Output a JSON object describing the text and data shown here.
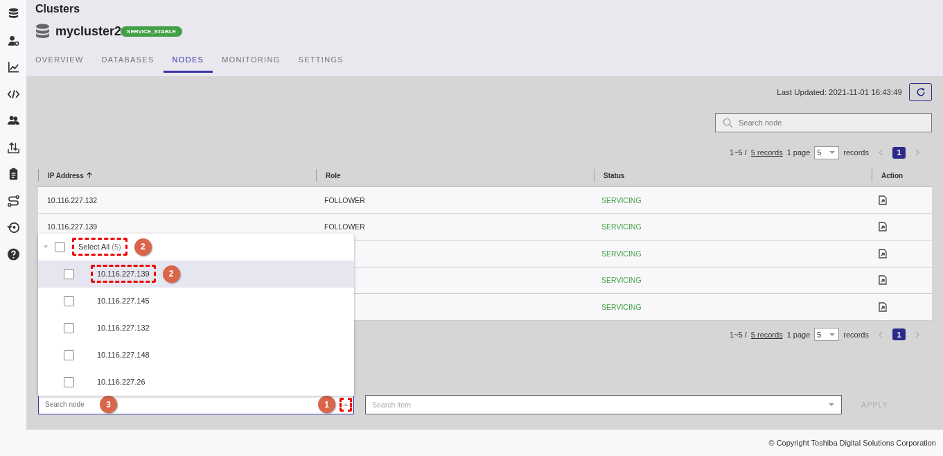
{
  "page": {
    "title": "Clusters"
  },
  "cluster": {
    "name": "mycluster2",
    "status": "SERVICE_STABLE"
  },
  "tabs": [
    {
      "label": "OVERVIEW",
      "selected": false
    },
    {
      "label": "DATABASES",
      "selected": false
    },
    {
      "label": "NODES",
      "selected": true
    },
    {
      "label": "MONITORING",
      "selected": false
    },
    {
      "label": "SETTINGS",
      "selected": false
    }
  ],
  "last_updated": "Last Updated: 2021-11-01 16:43:49",
  "search": {
    "placeholder": "Search node"
  },
  "pagination_top": {
    "range": "1~5 /",
    "records_link": "5 records",
    "per_page_label": "1 page",
    "per_page": "5",
    "records_label": "records",
    "page": "1"
  },
  "table": {
    "columns": [
      {
        "label": "IP Address",
        "sorted": true
      },
      {
        "label": "Role",
        "sorted": false
      },
      {
        "label": "Status",
        "sorted": false
      },
      {
        "label": "Action",
        "sorted": false
      }
    ],
    "rows": [
      {
        "ip": "10.116.227.132",
        "role": "FOLLOWER",
        "status": "SERVICING"
      },
      {
        "ip": "10.116.227.139",
        "role": "FOLLOWER",
        "status": "SERVICING"
      },
      {
        "status": "SERVICING"
      },
      {
        "status": "SERVICING"
      },
      {
        "status": "SERVICING"
      }
    ]
  },
  "pagination_bottom": {
    "range": "1~5 /",
    "records_link": "5 records",
    "per_page_label": "1 page",
    "per_page": "5",
    "records_label": "records",
    "page": "1"
  },
  "filter": {
    "node_dropdown": {
      "select_all": {
        "label": "Select All",
        "count": "(5)",
        "checked": false,
        "callout": "2"
      },
      "options": [
        {
          "label": "10.116.227.139",
          "checked": false,
          "selected": true,
          "callout": "2"
        },
        {
          "label": "10.116.227.145",
          "checked": false,
          "selected": false
        },
        {
          "label": "10.116.227.132",
          "checked": false,
          "selected": false
        },
        {
          "label": "10.116.227.148",
          "checked": false,
          "selected": false
        },
        {
          "label": "10.116.227.26",
          "checked": false,
          "selected": false
        }
      ],
      "search": {
        "placeholder": "Search node",
        "callout": "3"
      },
      "toggle_callout": "1"
    },
    "item_select": {
      "placeholder": "Search item"
    },
    "apply": "APPLY"
  },
  "footer": "© Copyright Toshiba Digital Solutions Corporation"
}
